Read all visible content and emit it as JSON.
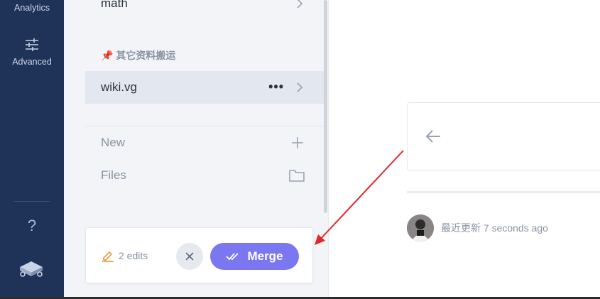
{
  "rail": {
    "analytics_label": "Analytics",
    "advanced_label": "Advanced",
    "help_label": "?"
  },
  "sidebar": {
    "math_label": "math",
    "section_title": "其它资料搬运",
    "section_pin": "📌",
    "active_item": {
      "label": "wiki.vg",
      "more": "•••"
    },
    "new_label": "New",
    "files_label": "Files"
  },
  "edits_bar": {
    "edits_count": "2 edits",
    "merge_label": "Merge"
  },
  "main": {
    "updated_text": "最近更新 7 seconds ago"
  },
  "colors": {
    "rail_bg": "#1f3358",
    "accent": "#7b77f0",
    "edit_icon": "#e8912d",
    "annotation": "#e0262b"
  }
}
